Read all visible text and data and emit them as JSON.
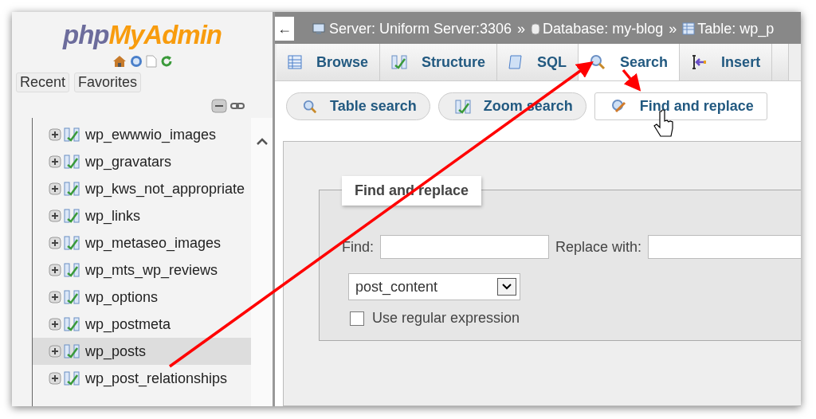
{
  "logo": {
    "php": "php",
    "name": "MyAdmin"
  },
  "nav_tabs": [
    {
      "label": "Recent",
      "selected": false
    },
    {
      "label": "Favorites",
      "selected": false
    }
  ],
  "tree": [
    {
      "label": "wp_ewwwio_images",
      "selected": false
    },
    {
      "label": "wp_gravatars",
      "selected": false
    },
    {
      "label": "wp_kws_not_appropriate",
      "selected": false
    },
    {
      "label": "wp_links",
      "selected": false
    },
    {
      "label": "wp_metaseo_images",
      "selected": false
    },
    {
      "label": "wp_mts_wp_reviews",
      "selected": false
    },
    {
      "label": "wp_options",
      "selected": false
    },
    {
      "label": "wp_postmeta",
      "selected": false
    },
    {
      "label": "wp_posts",
      "selected": true
    },
    {
      "label": "wp_post_relationships",
      "selected": false
    }
  ],
  "breadcrumb": [
    {
      "kind": "server",
      "label": "Server: Uniform Server:3306",
      "sep": "»"
    },
    {
      "kind": "database",
      "label": "Database: my-blog",
      "sep": "»"
    },
    {
      "kind": "table",
      "label": "Table: wp_p"
    }
  ],
  "back": "←",
  "tabs": [
    {
      "kind": "browse",
      "label": "Browse",
      "selected": false
    },
    {
      "kind": "structure",
      "label": "Structure",
      "selected": false
    },
    {
      "kind": "sql",
      "label": "SQL",
      "selected": false
    },
    {
      "kind": "search",
      "label": "Search",
      "selected": true
    },
    {
      "kind": "insert",
      "label": "Insert",
      "selected": false
    }
  ],
  "subtabs": [
    {
      "kind": "search",
      "label": "Table search",
      "selected": false
    },
    {
      "kind": "structure",
      "label": "Zoom search",
      "selected": false
    },
    {
      "kind": "replace",
      "label": "Find and replace",
      "selected": true
    }
  ],
  "form": {
    "legend": "Find and replace",
    "find_label": "Find:",
    "replace_label": "Replace with:",
    "column": "post_content",
    "regex": {
      "label": "Use regular expression",
      "checked": false
    }
  }
}
